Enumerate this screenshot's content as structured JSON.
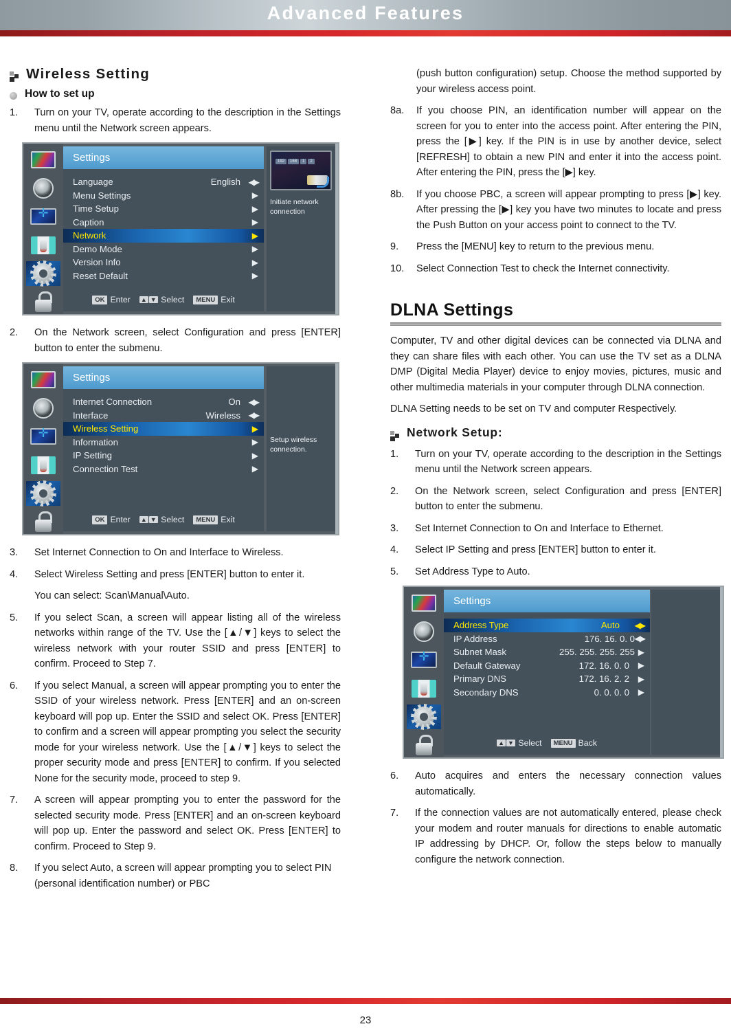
{
  "header": {
    "title": "Advanced Features"
  },
  "footer": {
    "page_number": "23"
  },
  "left_column": {
    "heading": "Wireless Setting",
    "subheading": "How to set up",
    "steps": [
      {
        "num": "1.",
        "text": "Turn on your TV, operate according to the description in the Settings menu until the Network screen appears."
      },
      {
        "num": "2.",
        "text": "On the Network screen, select Configuration and press [ENTER] button to enter the submenu."
      },
      {
        "num": "3.",
        "text": "Set Internet Connection to On and Interface to Wireless."
      },
      {
        "num": "4.",
        "text": "Select Wireless Setting and press [ENTER] button to enter it."
      }
    ],
    "note": "You can select: Scan\\Manual\\Auto.",
    "steps2": [
      {
        "num": "5.",
        "text": "If you select Scan, a screen will appear listing all of the wireless networks within range of the TV. Use the [▲/▼] keys to select the wireless network with your router SSID and press [ENTER] to confirm. Proceed to Step 7."
      },
      {
        "num": "6.",
        "text": "If you select Manual, a screen will appear prompting you to enter the SSID of your wireless network. Press [ENTER] and an on-screen keyboard will pop up.  Enter the SSID and select OK. Press [ENTER] to confirm and a screen will appear prompting you select the security mode for your wireless network. Use the [▲/▼] keys to select the proper security mode and press [ENTER] to confirm. If you selected None for the security mode, proceed to step 9."
      },
      {
        "num": "7.",
        "text": "A screen will appear prompting you to enter the password for the selected security mode. Press [ENTER] and an on-screen keyboard will pop up. Enter the password and select OK. Press [ENTER] to confirm. Proceed to Step 9."
      },
      {
        "num": "8.",
        "text": "If you select Auto, a screen will appear prompting you to select PIN (personal identification number) or PBC"
      }
    ]
  },
  "right_column": {
    "continuation": "(push button configuration) setup. Choose the method supported by your wireless access point.",
    "steps": [
      {
        "num": "8a.",
        "text": "If you choose PIN, an identification number will appear on the screen for you to enter into the access point. After entering the PIN, press the [▶] key. If the PIN is in use by another device, select [REFRESH] to obtain a new PIN and enter it into the access point. After entering the PIN, press the [▶] key."
      },
      {
        "num": "8b.",
        "text": "If you choose PBC, a screen will appear prompting to press [▶] key. After pressing the [▶] key you have two minutes to locate and press the Push Button on your access point to connect to the TV."
      },
      {
        "num": "9.",
        "text": "Press the [MENU] key to return to the previous menu."
      },
      {
        "num": "10.",
        "text": "Select Connection Test to check the Internet connectivity."
      }
    ],
    "section_title": "DLNA Settings",
    "paragraphs": [
      "Computer, TV and other digital devices can be connected via DLNA and they can share files with each other. You can use the TV set as a DLNA DMP (Digital Media Player) device to enjoy movies, pictures, music and other multimedia materials in your computer through DLNA connection.",
      "DLNA Setting needs to be set on TV and computer Respectively."
    ],
    "network_setup_heading": "Network Setup:",
    "network_steps": [
      {
        "num": "1.",
        "text": "Turn on your TV, operate according to the description in the Settings menu until the Network screen appears."
      },
      {
        "num": "2.",
        "text": "On the Network screen, select Configuration and press [ENTER] button to enter the submenu."
      },
      {
        "num": "3.",
        "text": "Set Internet Connection to On and Interface to Ethernet."
      },
      {
        "num": "4.",
        "text": "Select IP Setting and press [ENTER] button to enter it."
      },
      {
        "num": "5.",
        "text": "Set Address Type to Auto."
      }
    ],
    "network_steps2": [
      {
        "num": "6.",
        "text": "Auto acquires and enters the necessary connection values automatically."
      },
      {
        "num": "7.",
        "text": "If the connection values are not automatically entered, please check your modem and router manuals for directions to enable automatic IP addressing by DHCP. Or, follow the steps below to manually configure the network connection."
      }
    ]
  },
  "osd_settings_menu": {
    "title": "Settings",
    "rows": [
      {
        "label": "Language",
        "value": "English",
        "arrow": "lr",
        "selected": false
      },
      {
        "label": "Menu Settings",
        "value": "",
        "arrow": "r",
        "selected": false
      },
      {
        "label": "Time Setup",
        "value": "",
        "arrow": "r",
        "selected": false
      },
      {
        "label": "Caption",
        "value": "",
        "arrow": "r",
        "selected": false
      },
      {
        "label": "Network",
        "value": "",
        "arrow": "r",
        "selected": true
      },
      {
        "label": "Demo Mode",
        "value": "",
        "arrow": "r",
        "selected": false
      },
      {
        "label": "Version Info",
        "value": "",
        "arrow": "r",
        "selected": false
      },
      {
        "label": "Reset Default",
        "value": "",
        "arrow": "r",
        "selected": false
      }
    ],
    "hints": [
      {
        "key": "OK",
        "label": "Enter"
      },
      {
        "key": "▲▼",
        "label": "Select"
      },
      {
        "key": "MENU",
        "label": "Exit"
      }
    ],
    "side_text": "Initiate network connection",
    "thumb_ip": [
      "192",
      "168",
      "1",
      "2"
    ]
  },
  "osd_network_menu": {
    "title": "Settings",
    "rows": [
      {
        "label": "Internet Connection",
        "value": "On",
        "arrow": "lr",
        "selected": false
      },
      {
        "label": "Interface",
        "value": "Wireless",
        "arrow": "lr",
        "selected": false
      },
      {
        "label": "Wireless Setting",
        "value": "",
        "arrow": "r",
        "selected": true
      },
      {
        "label": "Information",
        "value": "",
        "arrow": "r",
        "selected": false
      },
      {
        "label": "IP Setting",
        "value": "",
        "arrow": "r",
        "selected": false
      },
      {
        "label": "Connection Test",
        "value": "",
        "arrow": "r",
        "selected": false
      }
    ],
    "hints": [
      {
        "key": "OK",
        "label": "Enter"
      },
      {
        "key": "▲▼",
        "label": "Select"
      },
      {
        "key": "MENU",
        "label": "Exit"
      }
    ],
    "side_text": "Setup wireless connection."
  },
  "osd_ip_menu": {
    "title": "Settings",
    "rows": [
      {
        "label": "Address Type",
        "value": "Auto",
        "arrow": "lr",
        "selected": true
      },
      {
        "label": "IP Address",
        "value": "176.   16.    0.     0",
        "arrow": "lr",
        "selected": false
      },
      {
        "label": "Subnet Mask",
        "value": "255.   255.   255.   255",
        "arrow": "r",
        "selected": false
      },
      {
        "label": "Default Gateway",
        "value": "172.   16.   0.    0",
        "arrow": "r",
        "selected": false
      },
      {
        "label": "Primary DNS",
        "value": "172.   16.   2.    2",
        "arrow": "r",
        "selected": false
      },
      {
        "label": "Secondary DNS",
        "value": "0.     0.    0.    0",
        "arrow": "r",
        "selected": false
      }
    ],
    "hints": [
      {
        "key": "▲▼",
        "label": "Select"
      },
      {
        "key": "MENU",
        "label": "Back"
      }
    ]
  },
  "colors": {
    "accent_red": "#d6282c",
    "osd_highlight_blue": "#1a63ad",
    "osd_highlight_text": "#ffe600",
    "osd_title_blue": "#63a9d6"
  }
}
